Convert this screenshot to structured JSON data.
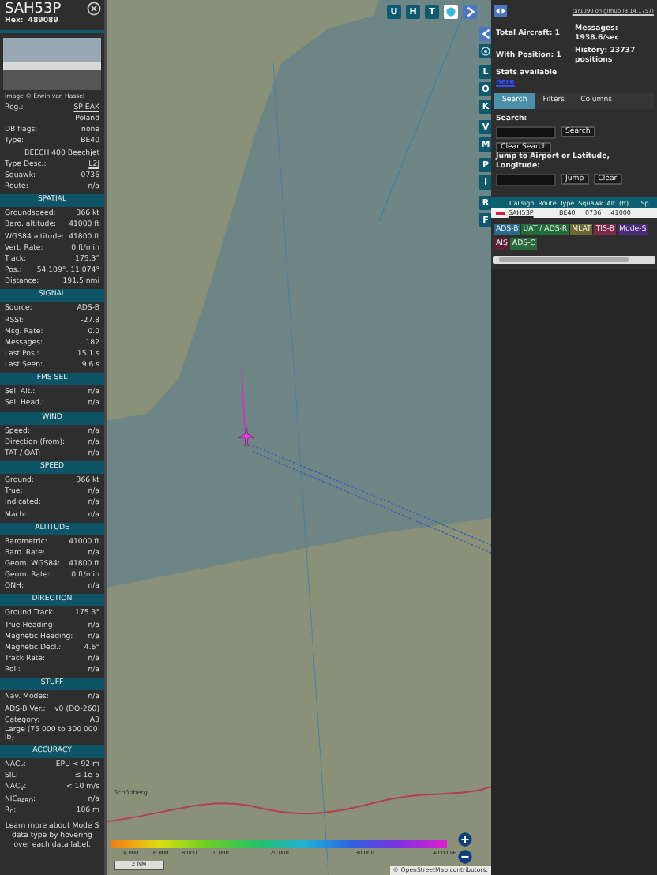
{
  "aircraft_panel": {
    "callsign": "SAH53P",
    "hex_label": "Hex:",
    "hex": "489089",
    "photo_caption": "Image © Erwin van Hassel",
    "details": [
      {
        "kind": "pair",
        "label": "Reg.:",
        "value": "SP-EAK",
        "link": true
      },
      {
        "kind": "line",
        "value": "Poland"
      },
      {
        "kind": "pair",
        "label": "DB flags:",
        "value": "none",
        "link": false
      },
      {
        "kind": "pair",
        "label": "Type:",
        "value": "BE40",
        "link": false
      },
      {
        "kind": "line",
        "value": "BEECH 400 Beechjet"
      },
      {
        "kind": "pair",
        "label": "Type Desc.:",
        "value": "L2J",
        "link": true
      },
      {
        "kind": "pair",
        "label": "Squawk:",
        "value": "0736",
        "link": false
      },
      {
        "kind": "pair",
        "label": "Route:",
        "value": "n/a",
        "link": false
      }
    ],
    "sections": [
      {
        "title": "SPATIAL",
        "rows": [
          {
            "kind": "pair",
            "label": "Groundspeed:",
            "value": "366 kt"
          },
          {
            "kind": "pair",
            "label": "Baro. altitude:",
            "value": "41000 ft"
          },
          {
            "kind": "pair",
            "label": "WGS84 altitude:",
            "value": "41800 ft"
          },
          {
            "kind": "pair",
            "label": "Vert. Rate:",
            "value": "0 ft/min"
          },
          {
            "kind": "pair",
            "label": "Track:",
            "value": "175.3°"
          },
          {
            "kind": "pair",
            "label": "Pos.:",
            "value": "54.109°, 11.074°"
          },
          {
            "kind": "pair",
            "label": "Distance:",
            "value": "191.5 nmi"
          }
        ]
      },
      {
        "title": "SIGNAL",
        "rows": [
          {
            "kind": "pair",
            "label": "Source:",
            "value": "ADS-B"
          },
          {
            "kind": "pair",
            "label": "RSSI:",
            "value": "-27.8"
          },
          {
            "kind": "pair",
            "label": "Msg. Rate:",
            "value": "0.0"
          },
          {
            "kind": "pair",
            "label": "Messages:",
            "value": "182"
          },
          {
            "kind": "pair",
            "label": "Last Pos.:",
            "value": "15.1 s"
          },
          {
            "kind": "pair",
            "label": "Last Seen:",
            "value": "9.6 s"
          }
        ]
      },
      {
        "title": "FMS SEL",
        "rows": [
          {
            "kind": "pair",
            "label": "Sel. Alt.:",
            "value": "n/a"
          },
          {
            "kind": "pair",
            "label": "Sel. Head.:",
            "value": "n/a"
          }
        ]
      },
      {
        "title": "WIND",
        "rows": [
          {
            "kind": "pair",
            "label": "Speed:",
            "value": "n/a"
          },
          {
            "kind": "pair",
            "label": "Direction (from):",
            "value": "n/a"
          },
          {
            "kind": "pair",
            "label": "TAT / OAT:",
            "value": "n/a"
          }
        ]
      },
      {
        "title": "SPEED",
        "rows": [
          {
            "kind": "pair",
            "label": "Ground:",
            "value": "366 kt"
          },
          {
            "kind": "pair",
            "label": "True:",
            "value": "n/a"
          },
          {
            "kind": "pair",
            "label": "Indicated:",
            "value": "n/a"
          },
          {
            "kind": "pair",
            "label": "Mach:",
            "value": "n/a"
          }
        ]
      },
      {
        "title": "ALTITUDE",
        "rows": [
          {
            "kind": "pair",
            "label": "Barometric:",
            "value": "41000 ft"
          },
          {
            "kind": "pair",
            "label": "Baro. Rate:",
            "value": "n/a"
          },
          {
            "kind": "pair",
            "label": "Geom. WGS84:",
            "value": "41800 ft"
          },
          {
            "kind": "pair",
            "label": "Geom. Rate:",
            "value": "0 ft/min"
          },
          {
            "kind": "pair",
            "label": "QNH:",
            "value": "n/a"
          }
        ]
      },
      {
        "title": "DIRECTION",
        "rows": [
          {
            "kind": "pair",
            "label": "Ground Track:",
            "value": "175.3°"
          },
          {
            "kind": "pair",
            "label": "True Heading:",
            "value": "n/a"
          },
          {
            "kind": "pair",
            "label": "Magnetic Heading:",
            "value": "n/a"
          },
          {
            "kind": "pair",
            "label": "Magnetic Decl.:",
            "value": "4.6°"
          },
          {
            "kind": "pair",
            "label": "Track Rate:",
            "value": "n/a"
          },
          {
            "kind": "pair",
            "label": "Roll:",
            "value": "n/a"
          }
        ]
      },
      {
        "title": "STUFF",
        "rows": [
          {
            "kind": "pair",
            "label": "Nav. Modes:",
            "value": "n/a"
          },
          {
            "kind": "pair",
            "label": "ADS-B Ver.:",
            "value": "v0 (DO-260)"
          },
          {
            "kind": "pair",
            "label": "Category:",
            "value": "A3"
          },
          {
            "kind": "note",
            "value": "Large (75 000 to 300 000 lb)"
          }
        ]
      },
      {
        "title": "ACCURACY",
        "rows": [
          {
            "kind": "pair",
            "label": "NAC$_{P}$:",
            "value": "EPU < 92 m"
          },
          {
            "kind": "pair",
            "label": "SIL:",
            "value": "≤ 1e-5"
          },
          {
            "kind": "pair",
            "label": "NAC$_{V}$:",
            "value": "< 10 m/s"
          },
          {
            "kind": "pair",
            "label": "NIC$_{BARO}$:",
            "value": "n/a"
          },
          {
            "kind": "pair",
            "label": "R$_{C}$:",
            "value": "186 m"
          }
        ]
      }
    ],
    "footer": "Learn more about Mode S data type by hovering over each data label."
  },
  "map": {
    "top_buttons": [
      {
        "label": "U"
      },
      {
        "label": "H"
      },
      {
        "label": "T"
      }
    ],
    "button_groups": [
      [
        {
          "label": "L"
        },
        {
          "label": "O"
        },
        {
          "label": "K"
        }
      ],
      [
        {
          "label": "V"
        },
        {
          "label": "M"
        }
      ],
      [
        {
          "label": "P"
        },
        {
          "label": "I"
        }
      ],
      [
        {
          "label": "R"
        },
        {
          "label": "F"
        }
      ]
    ],
    "place_label": "Schönberg",
    "altitude_scale": [
      "4 000",
      "6 000",
      "8 000",
      "10 000",
      "20 000",
      "30 000",
      "40 000+"
    ],
    "scale_bar": "2 NM",
    "attribution": "© OpenStreetMap contributors."
  },
  "side_panel": {
    "github_link": "tar1090 on github (3.14.1757)",
    "stats": [
      {
        "text": "Total Aircraft: 1"
      },
      {
        "text": "Messages: 1938.6/sec"
      },
      {
        "text": "With Position: 1"
      },
      {
        "text": "History: 23737 positions"
      }
    ],
    "stats_text": "Stats available",
    "stats_link": "here",
    "tabs": [
      {
        "label": "Search",
        "selected": true
      },
      {
        "label": "Filters",
        "selected": false
      },
      {
        "label": "Columns",
        "selected": false
      }
    ],
    "search_label": "Search:",
    "search_button": "Search",
    "clear_search_button": "Clear Search",
    "jump_label": "Jump to Airport or Latitude, Longitude:",
    "jump_button": "Jump",
    "clear_button": "Clear",
    "table": {
      "columns": [
        "Callsign",
        "Route",
        "Type",
        "Squawk",
        "Alt. (ft)",
        "Sp"
      ],
      "rows": [
        {
          "callsign": "SAH53P",
          "type": "BE40",
          "squawk": "0736",
          "altitude": "41000",
          "selected": true
        }
      ]
    },
    "badges": [
      {
        "label": "ADS-B",
        "color": "#2a6b8a"
      },
      {
        "label": "UAT / ADS-R",
        "color": "#246b3a"
      },
      {
        "label": "MLAT",
        "color": "#6e6630"
      },
      {
        "label": "TIS-B",
        "color": "#7a2a48"
      },
      {
        "label": "Mode-S",
        "color": "#4b2a78"
      },
      {
        "label": "AIS",
        "color": "#5e1f3a"
      },
      {
        "label": "ADS-C",
        "color": "#2b6a3a"
      }
    ]
  }
}
